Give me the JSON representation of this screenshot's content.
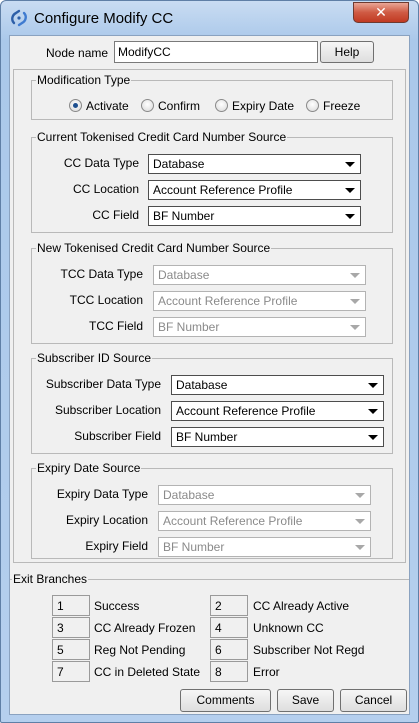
{
  "window": {
    "title": "Configure Modify CC",
    "close_glyph": "✕"
  },
  "node_name": {
    "label": "Node name",
    "value": "ModifyCC",
    "help_label": "Help"
  },
  "modification_type": {
    "legend": "Modification Type",
    "options": [
      "Activate",
      "Confirm",
      "Expiry Date",
      "Freeze"
    ],
    "selected": "Activate"
  },
  "current_source": {
    "legend": "Current Tokenised Credit Card Number Source",
    "rows": [
      {
        "label": "CC Data Type",
        "value": "Database"
      },
      {
        "label": "CC Location",
        "value": "Account Reference Profile"
      },
      {
        "label": "CC Field",
        "value": "BF Number"
      }
    ]
  },
  "new_source": {
    "legend": "New Tokenised Credit Card Number Source",
    "rows": [
      {
        "label": "TCC Data Type",
        "value": "Database"
      },
      {
        "label": "TCC Location",
        "value": "Account Reference Profile"
      },
      {
        "label": "TCC Field",
        "value": "BF Number"
      }
    ]
  },
  "subscriber_source": {
    "legend": "Subscriber ID Source",
    "rows": [
      {
        "label": "Subscriber Data Type",
        "value": "Database"
      },
      {
        "label": "Subscriber Location",
        "value": "Account Reference Profile"
      },
      {
        "label": "Subscriber Field",
        "value": "BF Number"
      }
    ]
  },
  "expiry_source": {
    "legend": "Expiry Date Source",
    "rows": [
      {
        "label": "Expiry Data Type",
        "value": "Database"
      },
      {
        "label": "Expiry Location",
        "value": "Account Reference Profile"
      },
      {
        "label": "Expiry Field",
        "value": "BF Number"
      }
    ]
  },
  "exit_branches": {
    "legend": "Exit Branches",
    "items": [
      {
        "num": "1",
        "label": "Success"
      },
      {
        "num": "2",
        "label": "CC Already Active"
      },
      {
        "num": "3",
        "label": "CC Already Frozen"
      },
      {
        "num": "4",
        "label": "Unknown CC"
      },
      {
        "num": "5",
        "label": "Reg Not Pending"
      },
      {
        "num": "6",
        "label": "Subscriber Not Regd"
      },
      {
        "num": "7",
        "label": "CC in Deleted State"
      },
      {
        "num": "8",
        "label": "Error"
      }
    ]
  },
  "footer": {
    "comments_label": "Comments",
    "save_label": "Save",
    "cancel_label": "Cancel"
  }
}
